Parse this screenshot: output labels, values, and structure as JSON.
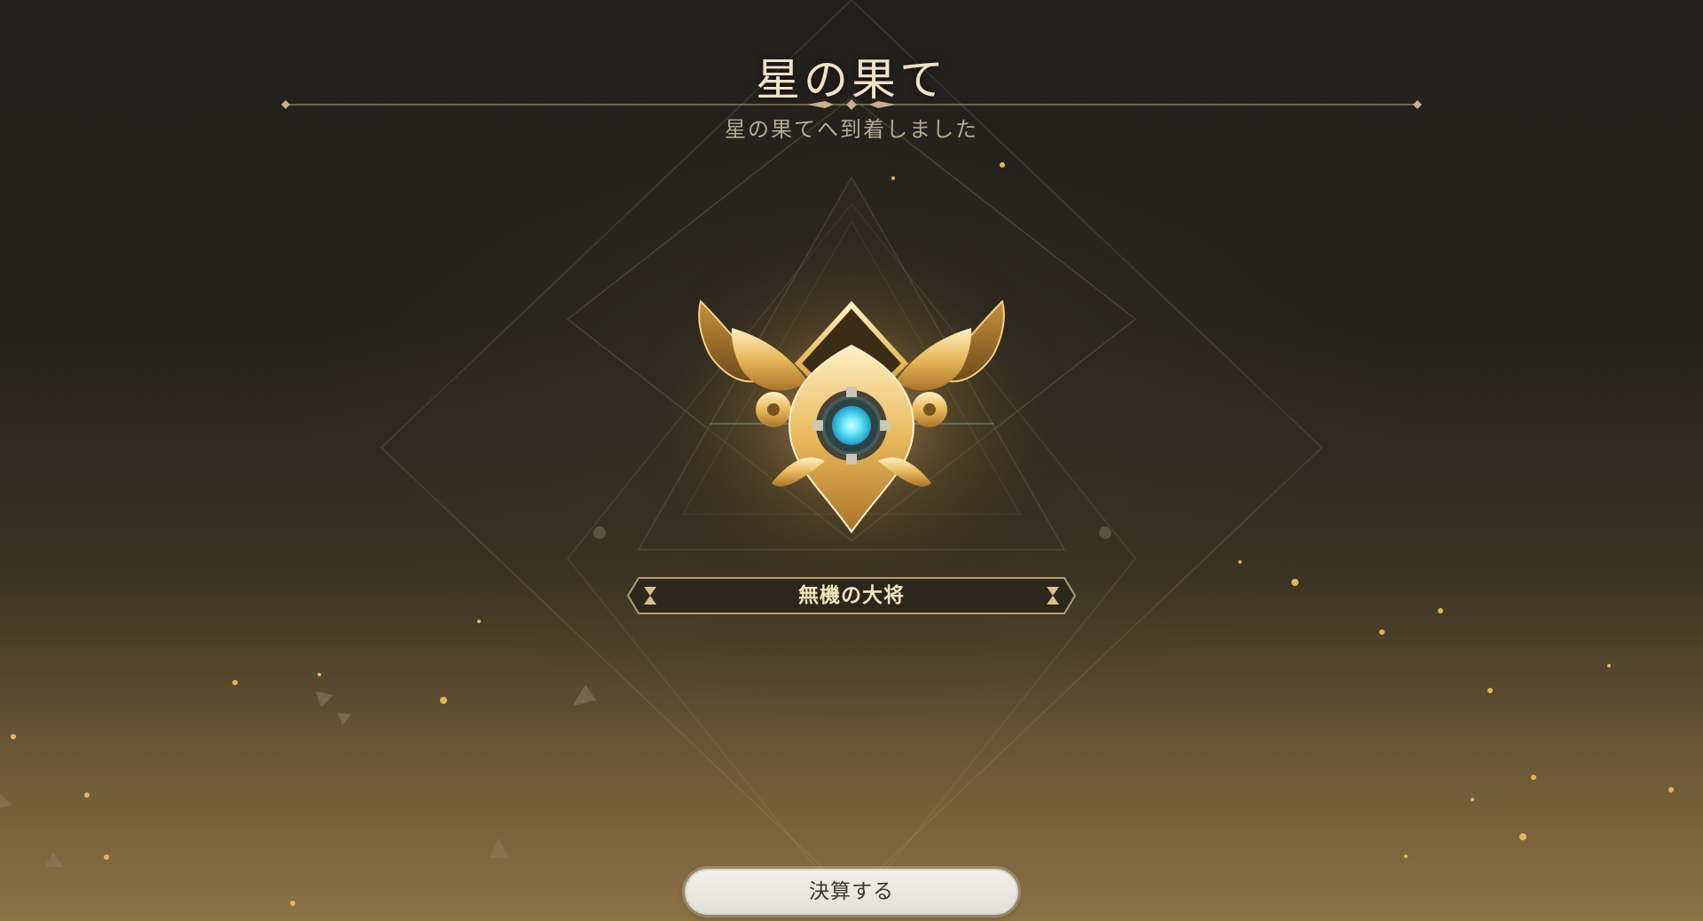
{
  "screen": {
    "title": "星の果て",
    "subtitle": "星の果てへ到着しました"
  },
  "badge": {
    "icon": "winged-gear-rank-emblem",
    "rank_name": "無機の大将",
    "gem_color": "#38d8ff",
    "gold_color": "#e8b85a"
  },
  "actions": {
    "settle_label": "決算する"
  }
}
